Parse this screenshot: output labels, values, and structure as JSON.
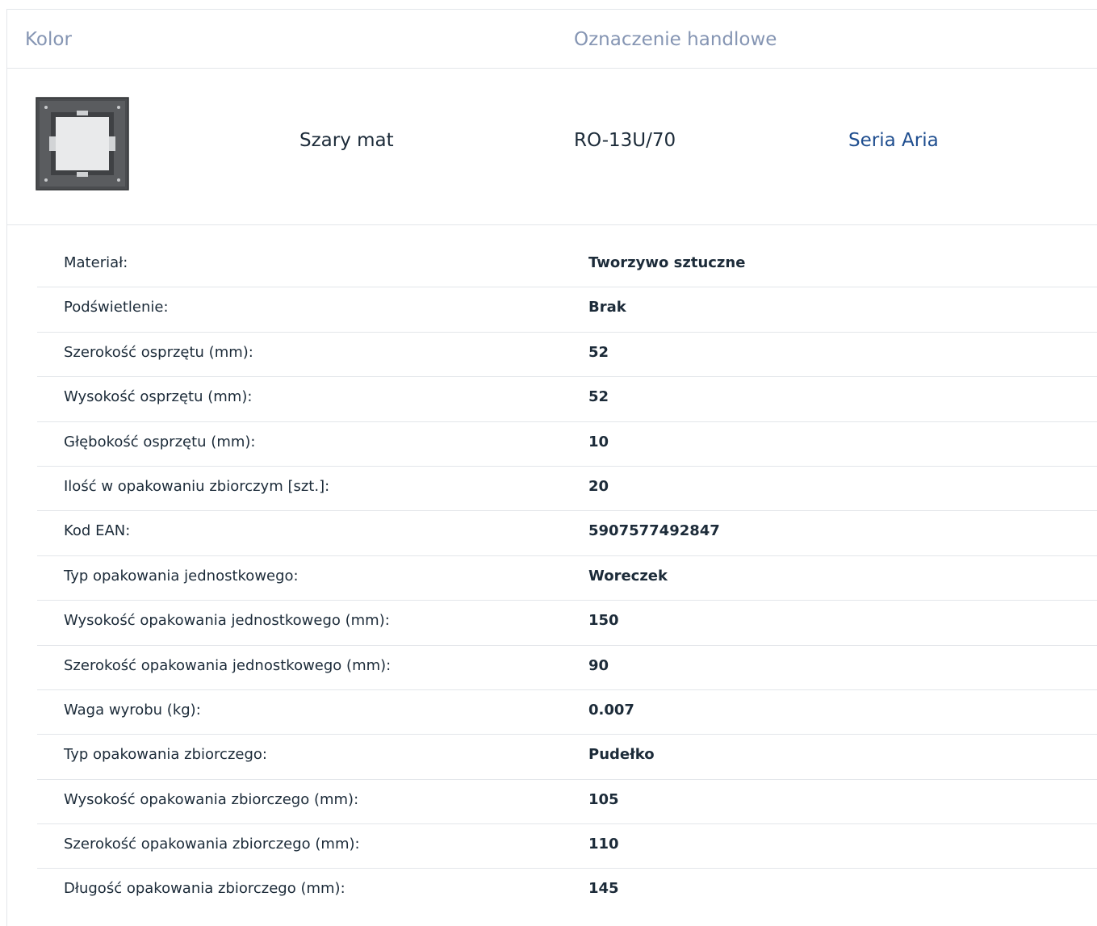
{
  "header": {
    "color_label": "Kolor",
    "trade_name_label": "Oznaczenie handlowe"
  },
  "product": {
    "thumbnail_icon": "gray-matte-frame-thumbnail",
    "color_value": "Szary mat",
    "trade_code": "RO-13U/70",
    "series_link": "Seria Aria"
  },
  "specs": [
    {
      "label": "Materiał:",
      "value": "Tworzywo sztuczne"
    },
    {
      "label": "Podświetlenie:",
      "value": "Brak"
    },
    {
      "label": "Szerokość osprzętu (mm):",
      "value": "52"
    },
    {
      "label": "Wysokość osprzętu (mm):",
      "value": "52"
    },
    {
      "label": "Głębokość osprzętu (mm):",
      "value": "10"
    },
    {
      "label": "Ilość w opakowaniu zbiorczym [szt.]:",
      "value": "20"
    },
    {
      "label": "Kod EAN:",
      "value": "5907577492847"
    },
    {
      "label": "Typ opakowania jednostkowego:",
      "value": "Woreczek"
    },
    {
      "label": "Wysokość opakowania jednostkowego (mm):",
      "value": "150"
    },
    {
      "label": "Szerokość opakowania jednostkowego (mm):",
      "value": "90"
    },
    {
      "label": "Waga wyrobu (kg):",
      "value": "0.007"
    },
    {
      "label": "Typ opakowania zbiorczego:",
      "value": "Pudełko"
    },
    {
      "label": "Wysokość opakowania zbiorczego (mm):",
      "value": "105"
    },
    {
      "label": "Szerokość opakowania zbiorczego (mm):",
      "value": "110"
    },
    {
      "label": "Długość opakowania zbiorczego (mm):",
      "value": "145"
    }
  ],
  "colors": {
    "header_text": "#8595b3",
    "body_text": "#1c2b39",
    "link": "#1f4e8f",
    "divider": "#e3e6ea"
  }
}
